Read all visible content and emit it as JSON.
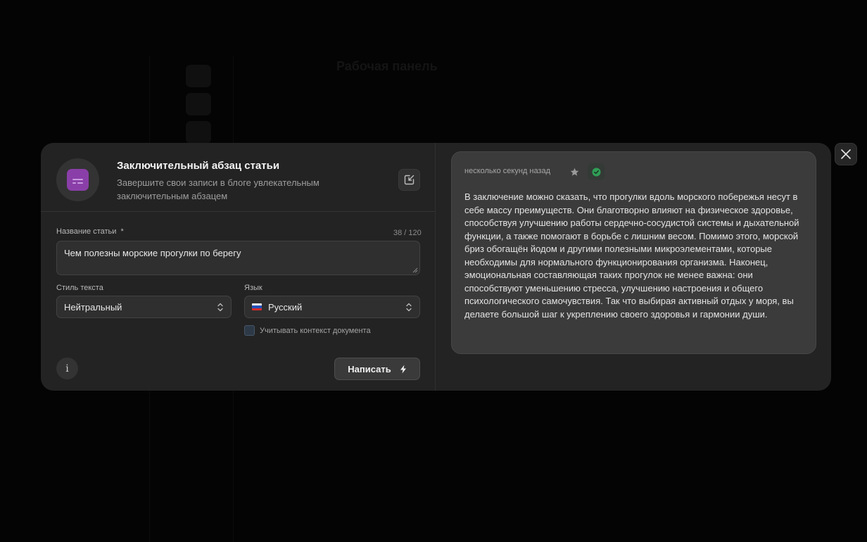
{
  "background": {
    "title": "Рабочая панель"
  },
  "tool": {
    "title": "Заключительный абзац статьи",
    "description": "Завершите свои записи в блоге увлекательным заключительным абзацем",
    "icon": "article-paragraph-icon",
    "accent_color": "#8a3fa8"
  },
  "form": {
    "title_label": "Название статьи",
    "required_mark": "*",
    "counter": "38 / 120",
    "title_value": "Чем полезны морские прогулки по берегу",
    "style_label": "Стиль текста",
    "style_value": "Нейтральный",
    "language_label": "Язык",
    "language_value": "Русский",
    "context_label": "Учитывать контекст документа",
    "info_symbol": "i",
    "submit_label": "Написать"
  },
  "result": {
    "timestamp": "несколько секунд назад",
    "text": "В заключение можно сказать, что прогулки вдоль морского побережья несут в себе массу преимуществ. Они благотворно влияют на физическое здоровье, способствуя улучшению работы сердечно-сосудистой системы и дыхательной функции, а также помогают в борьбе с лишним весом. Помимо этого, морской бриз обогащён йодом и другими полезными микроэлементами, которые необходимы для нормального функционирования организма. Наконец, эмоциональная составляющая таких прогулок не менее важна: они способствуют уменьшению стресса, улучшению настроения и общего психологического самочувствия. Так что выбирая активный отдых у моря, вы делаете большой шаг к укреплению своего здоровья и гармонии души."
  }
}
